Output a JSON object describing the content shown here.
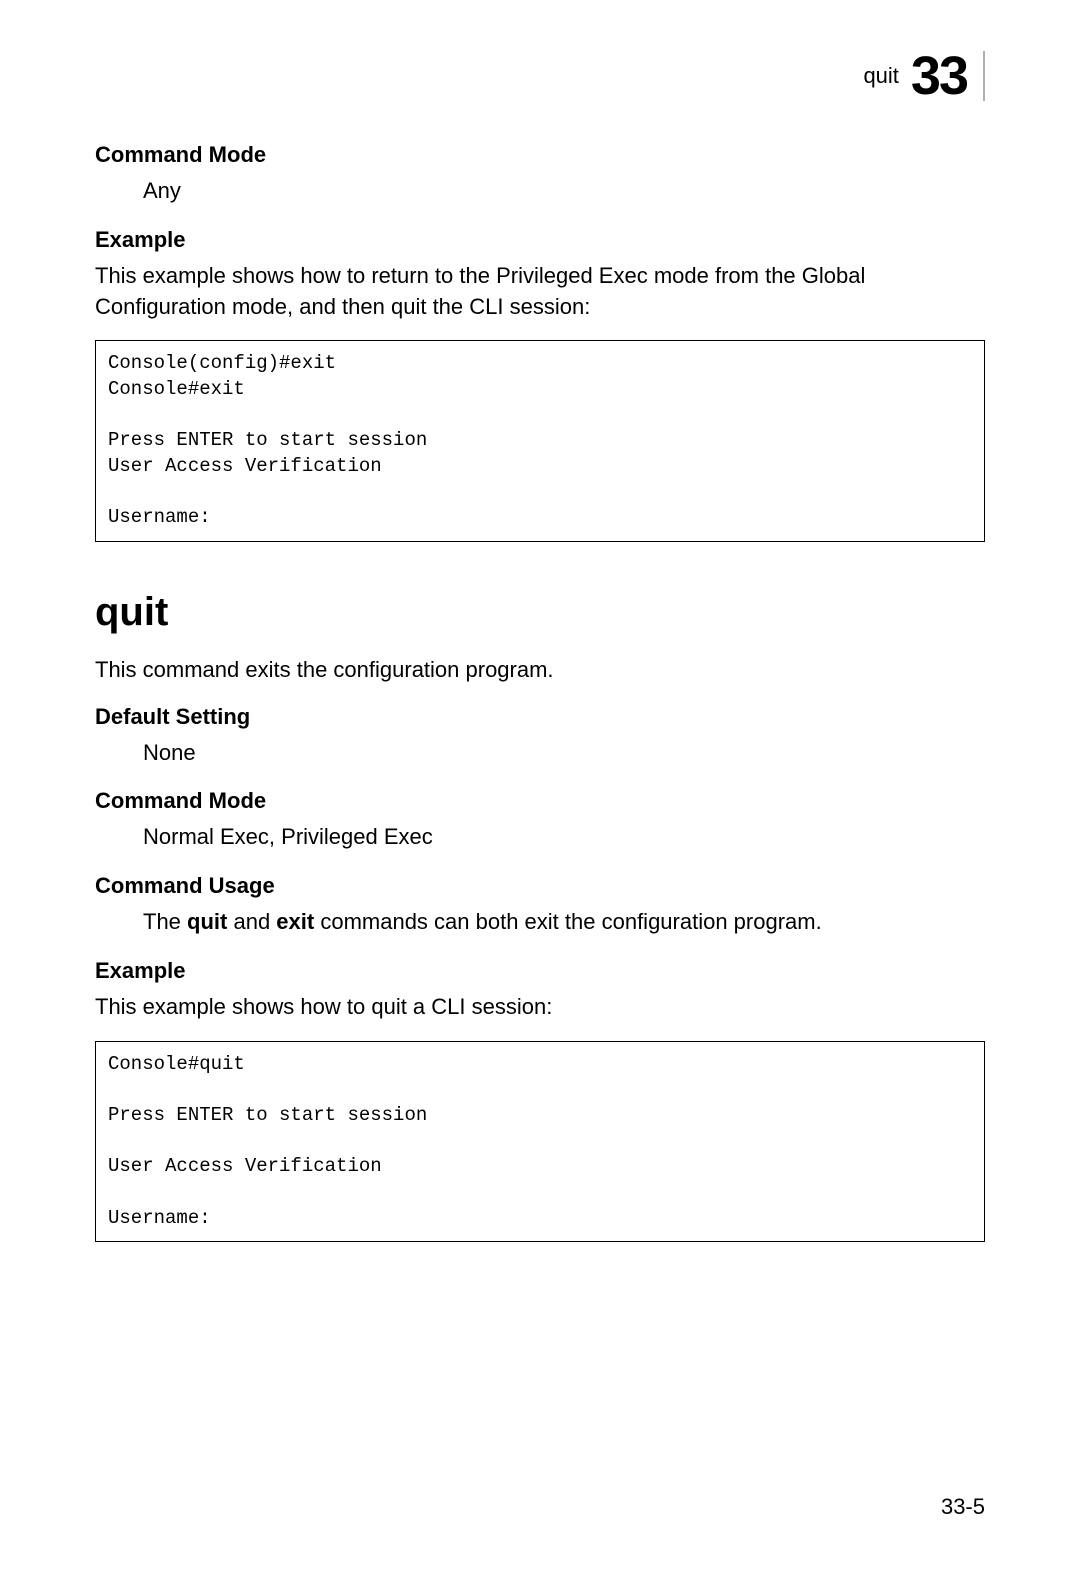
{
  "header": {
    "label": "quit",
    "chapter_number": "33"
  },
  "section1": {
    "heading": "Command Mode",
    "value": "Any"
  },
  "section2": {
    "heading": "Example",
    "description": "This example shows how to return to the Privileged Exec mode from the Global Configuration mode, and then quit the CLI session:",
    "code": "Console(config)#exit\nConsole#exit\n\nPress ENTER to start session\nUser Access Verification\n\nUsername:"
  },
  "main_title": "quit",
  "main_description": "This command exits the configuration program.",
  "section3": {
    "heading": "Default Setting",
    "value": "None"
  },
  "section4": {
    "heading": "Command Mode",
    "value": "Normal Exec, Privileged Exec"
  },
  "section5": {
    "heading": "Command Usage",
    "prefix": "The ",
    "bold1": "quit",
    "mid": " and ",
    "bold2": "exit",
    "suffix": " commands can both exit the configuration program."
  },
  "section6": {
    "heading": "Example",
    "description": "This example shows how to quit a CLI session:",
    "code": "Console#quit\n\nPress ENTER to start session\n\nUser Access Verification\n\nUsername:"
  },
  "page_number": "33-5"
}
